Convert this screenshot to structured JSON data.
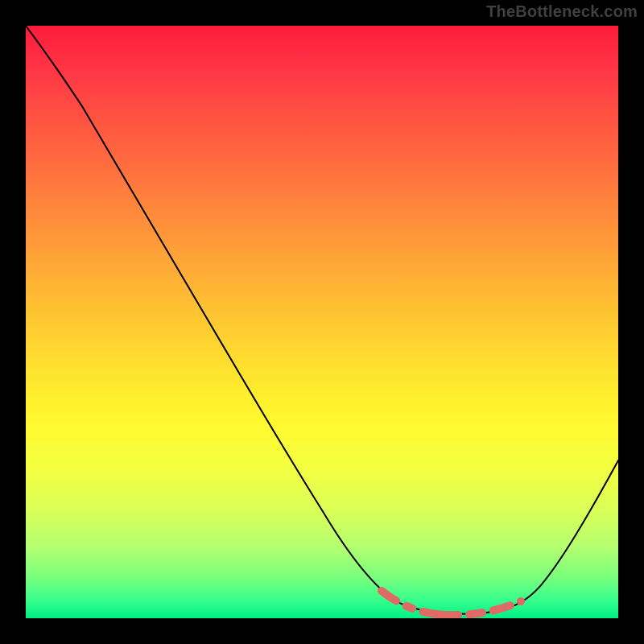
{
  "watermark": "TheBottleneck.com",
  "chart_data": {
    "type": "line",
    "title": "",
    "xlabel": "",
    "ylabel": "",
    "xlim": [
      0,
      100
    ],
    "ylim": [
      0,
      100
    ],
    "background": "rainbow-vertical-gradient",
    "series": [
      {
        "name": "curve",
        "x": [
          0,
          5,
          10,
          15,
          20,
          25,
          30,
          35,
          40,
          45,
          50,
          55,
          60,
          62,
          65,
          68,
          72,
          76,
          80,
          84,
          88,
          92,
          96,
          100
        ],
        "y": [
          100,
          96,
          91,
          85,
          78,
          71,
          63,
          55,
          47,
          39,
          31,
          23,
          15,
          12,
          8,
          5,
          3,
          2,
          2,
          3,
          6,
          12,
          20,
          30
        ]
      },
      {
        "name": "dashed-highlight",
        "style": "dashed",
        "color": "#e06a66",
        "x": [
          60,
          64,
          68,
          72,
          76,
          80,
          84
        ],
        "y": [
          8,
          5,
          3,
          2,
          2,
          2,
          3
        ]
      }
    ]
  }
}
